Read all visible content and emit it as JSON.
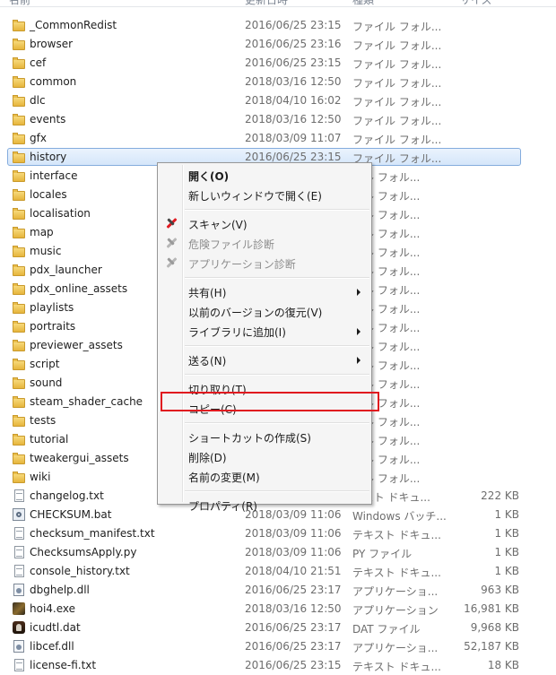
{
  "colors": {
    "selection_border": "#84acdd",
    "annotation_red": "#e0191f",
    "menu_bg": "#f5f5f5"
  },
  "header": {
    "name": "名前",
    "date": "更新日時",
    "type": "種類",
    "size": "サイズ"
  },
  "files": [
    {
      "name": "_CommonRedist",
      "date": "2016/06/25 23:15",
      "type": "ファイル フォル...",
      "size": "",
      "icon": "folder-icon"
    },
    {
      "name": "browser",
      "date": "2016/06/25 23:16",
      "type": "ファイル フォル...",
      "size": "",
      "icon": "folder-icon"
    },
    {
      "name": "cef",
      "date": "2016/06/25 23:15",
      "type": "ファイル フォル...",
      "size": "",
      "icon": "folder-icon"
    },
    {
      "name": "common",
      "date": "2018/03/16 12:50",
      "type": "ファイル フォル...",
      "size": "",
      "icon": "folder-icon"
    },
    {
      "name": "dlc",
      "date": "2018/04/10 16:02",
      "type": "ファイル フォル...",
      "size": "",
      "icon": "folder-icon"
    },
    {
      "name": "events",
      "date": "2018/03/16 12:50",
      "type": "ファイル フォル...",
      "size": "",
      "icon": "folder-icon"
    },
    {
      "name": "gfx",
      "date": "2018/03/09 11:07",
      "type": "ファイル フォル...",
      "size": "",
      "icon": "folder-icon"
    },
    {
      "name": "history",
      "date": "2016/06/25 23:15",
      "type": "ファイル フォル...",
      "size": "",
      "icon": "folder-icon",
      "selected": true
    },
    {
      "name": "interface",
      "date": "",
      "type": "イル フォル...",
      "size": "",
      "icon": "folder-icon"
    },
    {
      "name": "locales",
      "date": "",
      "type": "イル フォル...",
      "size": "",
      "icon": "folder-icon"
    },
    {
      "name": "localisation",
      "date": "",
      "type": "イル フォル...",
      "size": "",
      "icon": "folder-icon"
    },
    {
      "name": "map",
      "date": "",
      "type": "イル フォル...",
      "size": "",
      "icon": "folder-icon"
    },
    {
      "name": "music",
      "date": "",
      "type": "イル フォル...",
      "size": "",
      "icon": "folder-icon"
    },
    {
      "name": "pdx_launcher",
      "date": "",
      "type": "イル フォル...",
      "size": "",
      "icon": "folder-icon"
    },
    {
      "name": "pdx_online_assets",
      "date": "",
      "type": "イル フォル...",
      "size": "",
      "icon": "folder-icon"
    },
    {
      "name": "playlists",
      "date": "",
      "type": "イル フォル...",
      "size": "",
      "icon": "folder-icon"
    },
    {
      "name": "portraits",
      "date": "",
      "type": "イル フォル...",
      "size": "",
      "icon": "folder-icon"
    },
    {
      "name": "previewer_assets",
      "date": "",
      "type": "イル フォル...",
      "size": "",
      "icon": "folder-icon"
    },
    {
      "name": "script",
      "date": "",
      "type": "イル フォル...",
      "size": "",
      "icon": "folder-icon"
    },
    {
      "name": "sound",
      "date": "",
      "type": "イル フォル...",
      "size": "",
      "icon": "folder-icon"
    },
    {
      "name": "steam_shader_cache",
      "date": "",
      "type": "イル フォル...",
      "size": "",
      "icon": "folder-icon"
    },
    {
      "name": "tests",
      "date": "",
      "type": "イル フォル...",
      "size": "",
      "icon": "folder-icon"
    },
    {
      "name": "tutorial",
      "date": "",
      "type": "イル フォル...",
      "size": "",
      "icon": "folder-icon"
    },
    {
      "name": "tweakergui_assets",
      "date": "",
      "type": "イル フォル...",
      "size": "",
      "icon": "folder-icon"
    },
    {
      "name": "wiki",
      "date": "",
      "type": "イル フォル...",
      "size": "",
      "icon": "folder-icon"
    },
    {
      "name": "changelog.txt",
      "date": "",
      "type": "キスト ドキュ...",
      "size": "222 KB",
      "icon": "text-file-icon"
    },
    {
      "name": "CHECKSUM.bat",
      "date": "2018/03/09 11:06",
      "type": "Windows バッチ...",
      "size": "1 KB",
      "icon": "batch-file-icon"
    },
    {
      "name": "checksum_manifest.txt",
      "date": "2018/03/09 11:06",
      "type": "テキスト ドキュ...",
      "size": "1 KB",
      "icon": "text-file-icon"
    },
    {
      "name": "ChecksumsApply.py",
      "date": "2018/03/09 11:06",
      "type": "PY ファイル",
      "size": "1 KB",
      "icon": "blank-file-icon"
    },
    {
      "name": "console_history.txt",
      "date": "2018/04/10 21:51",
      "type": "テキスト ドキュ...",
      "size": "1 KB",
      "icon": "text-file-icon"
    },
    {
      "name": "dbghelp.dll",
      "date": "2016/06/25 23:17",
      "type": "アプリケーショ...",
      "size": "963 KB",
      "icon": "dll-file-icon"
    },
    {
      "name": "hoi4.exe",
      "date": "2018/03/16 12:50",
      "type": "アプリケーション",
      "size": "16,981 KB",
      "icon": "game-exe-icon"
    },
    {
      "name": "icudtl.dat",
      "date": "2016/06/25 23:17",
      "type": "DAT ファイル",
      "size": "9,968 KB",
      "icon": "dat-file-icon"
    },
    {
      "name": "libcef.dll",
      "date": "2016/06/25 23:17",
      "type": "アプリケーショ...",
      "size": "52,187 KB",
      "icon": "dll-file-icon"
    },
    {
      "name": "license-fi.txt",
      "date": "2016/06/25 23:15",
      "type": "テキスト ドキュ...",
      "size": "18 KB",
      "icon": "text-file-icon"
    }
  ],
  "context_menu": {
    "items": [
      {
        "label": "開く(O)",
        "bold": true
      },
      {
        "label": "新しいウィンドウで開く(E)"
      },
      {
        "sep": true
      },
      {
        "label": "スキャン(V)",
        "icon": "scan-icon"
      },
      {
        "label": "危険ファイル診断",
        "icon": "gray-scan-icon",
        "disabled": true
      },
      {
        "label": "アプリケーション診断",
        "icon": "gray-scan-icon",
        "disabled": true
      },
      {
        "sep": true
      },
      {
        "label": "共有(H)",
        "submenu": true
      },
      {
        "label": "以前のバージョンの復元(V)"
      },
      {
        "label": "ライブラリに追加(I)",
        "submenu": true
      },
      {
        "sep": true
      },
      {
        "label": "送る(N)",
        "submenu": true
      },
      {
        "sep": true
      },
      {
        "label": "切り取り(T)"
      },
      {
        "label": "コピー(C)",
        "highlighted": true
      },
      {
        "sep": true
      },
      {
        "label": "ショートカットの作成(S)"
      },
      {
        "label": "削除(D)"
      },
      {
        "label": "名前の変更(M)"
      },
      {
        "sep": true
      },
      {
        "label": "プロパティ(R)"
      }
    ]
  }
}
